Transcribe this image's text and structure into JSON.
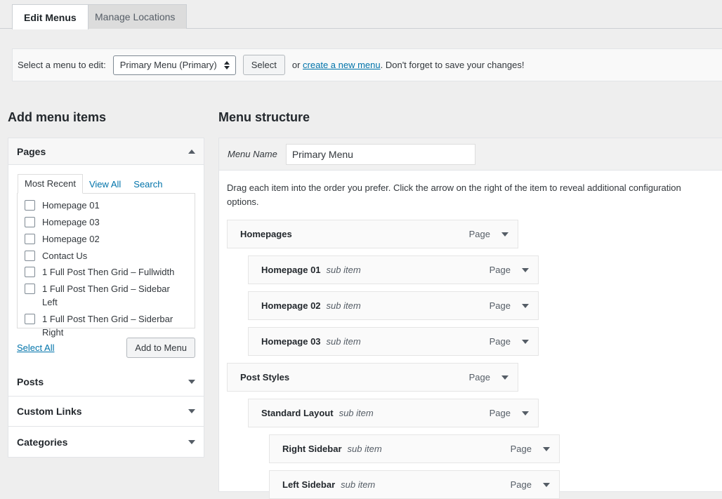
{
  "tabs": [
    {
      "label": "Edit Menus",
      "active": true
    },
    {
      "label": "Manage Locations",
      "active": false
    }
  ],
  "select_bar": {
    "label": "Select a menu to edit:",
    "selected_menu": "Primary Menu (Primary)",
    "select_button": "Select",
    "or_text": "or",
    "create_link": "create a new menu",
    "reminder": ". Don't forget to save your changes!"
  },
  "add_menu_items": {
    "heading": "Add menu items",
    "panels": [
      {
        "label": "Pages",
        "expanded": true
      },
      {
        "label": "Posts",
        "expanded": false
      },
      {
        "label": "Custom Links",
        "expanded": false
      },
      {
        "label": "Categories",
        "expanded": false
      }
    ],
    "pages_panel": {
      "tabs": [
        {
          "label": "Most Recent",
          "active": true
        },
        {
          "label": "View All",
          "active": false
        },
        {
          "label": "Search",
          "active": false
        }
      ],
      "items": [
        {
          "label": "Homepage 01",
          "checked": false
        },
        {
          "label": "Homepage 03",
          "checked": false
        },
        {
          "label": "Homepage 02",
          "checked": false
        },
        {
          "label": "Contact Us",
          "checked": false
        },
        {
          "label": "1 Full Post Then Grid – Fullwidth",
          "checked": false
        },
        {
          "label": "1 Full Post Then Grid – Sidebar Left",
          "checked": false
        },
        {
          "label": "1 Full Post Then Grid – Siderbar Right",
          "checked": false
        }
      ],
      "select_all": "Select All",
      "add_to_menu": "Add to Menu"
    }
  },
  "menu_structure": {
    "heading": "Menu structure",
    "menu_name_label": "Menu Name",
    "menu_name_value": "Primary Menu",
    "menu_name_placeholder": "Menu Name",
    "drag_hint": "Drag each item into the order you prefer. Click the arrow on the right of the item to reveal additional configuration options.",
    "items": [
      {
        "title": "Homepages",
        "sub_label": "",
        "type": "Page",
        "depth": 0
      },
      {
        "title": "Homepage 01",
        "sub_label": "sub item",
        "type": "Page",
        "depth": 1
      },
      {
        "title": "Homepage 02",
        "sub_label": "sub item",
        "type": "Page",
        "depth": 1
      },
      {
        "title": "Homepage 03",
        "sub_label": "sub item",
        "type": "Page",
        "depth": 1
      },
      {
        "title": "Post Styles",
        "sub_label": "",
        "type": "Page",
        "depth": 0
      },
      {
        "title": "Standard Layout",
        "sub_label": "sub item",
        "type": "Page",
        "depth": 1
      },
      {
        "title": "Right Sidebar",
        "sub_label": "sub item",
        "type": "Page",
        "depth": 2
      },
      {
        "title": "Left Sidebar",
        "sub_label": "sub item",
        "type": "Page",
        "depth": 2
      }
    ]
  },
  "colors": {
    "page_background": "#eeeeee",
    "panel_background": "#ffffff",
    "link": "#0073aa",
    "item_background": "#fafafa",
    "border": "#e2e4e7",
    "text": "#32373c"
  }
}
